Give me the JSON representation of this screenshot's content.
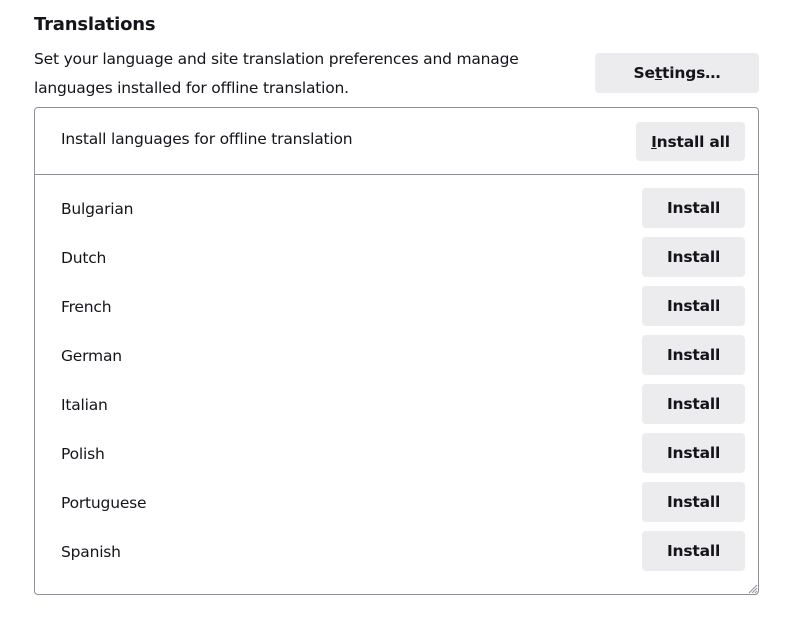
{
  "section": {
    "title": "Translations",
    "description": "Set your language and site translation preferences and manage languages installed for offline translation.",
    "settings_button": {
      "before": "Se",
      "accesskey": "t",
      "after": "tings…"
    }
  },
  "offline": {
    "header_label": "Install languages for offline translation",
    "install_all_button": {
      "accesskey": "I",
      "after": "nstall all"
    },
    "languages": [
      {
        "name": "Bulgarian",
        "button": "Install"
      },
      {
        "name": "Dutch",
        "button": "Install"
      },
      {
        "name": "French",
        "button": "Install"
      },
      {
        "name": "German",
        "button": "Install"
      },
      {
        "name": "Italian",
        "button": "Install"
      },
      {
        "name": "Polish",
        "button": "Install"
      },
      {
        "name": "Portuguese",
        "button": "Install"
      },
      {
        "name": "Spanish",
        "button": "Install"
      }
    ]
  }
}
